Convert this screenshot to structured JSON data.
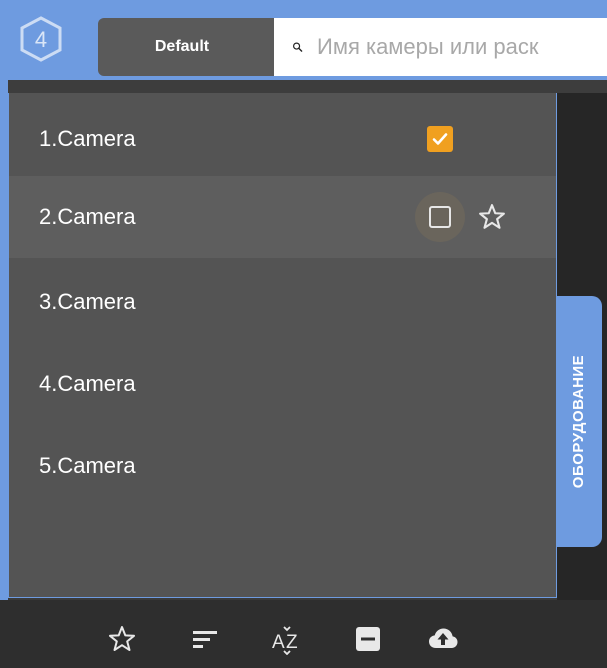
{
  "header": {
    "logo_text": "4",
    "tab_label": "Default",
    "search_placeholder": "Имя камеры или раск",
    "search_icon": "search-icon"
  },
  "cameras": [
    {
      "label": "1.Camera",
      "checked": true
    },
    {
      "label": "2.Camera",
      "checked": false,
      "hovered": true
    },
    {
      "label": "3.Camera"
    },
    {
      "label": "4.Camera"
    },
    {
      "label": "5.Camera"
    }
  ],
  "side_tab": {
    "label": "ОБОРУДОВАНИЕ"
  },
  "bottom_toolbar": {
    "icons": [
      "star-icon",
      "sort-icon",
      "az-sort-icon",
      "collapse-icon",
      "upload-cloud-icon"
    ]
  },
  "colors": {
    "accent": "#6e9be0",
    "checkbox": "#f0a020",
    "panel": "#545454",
    "panel_hover": "#5e5e5e",
    "bottom_bar": "#2e2e2e"
  }
}
